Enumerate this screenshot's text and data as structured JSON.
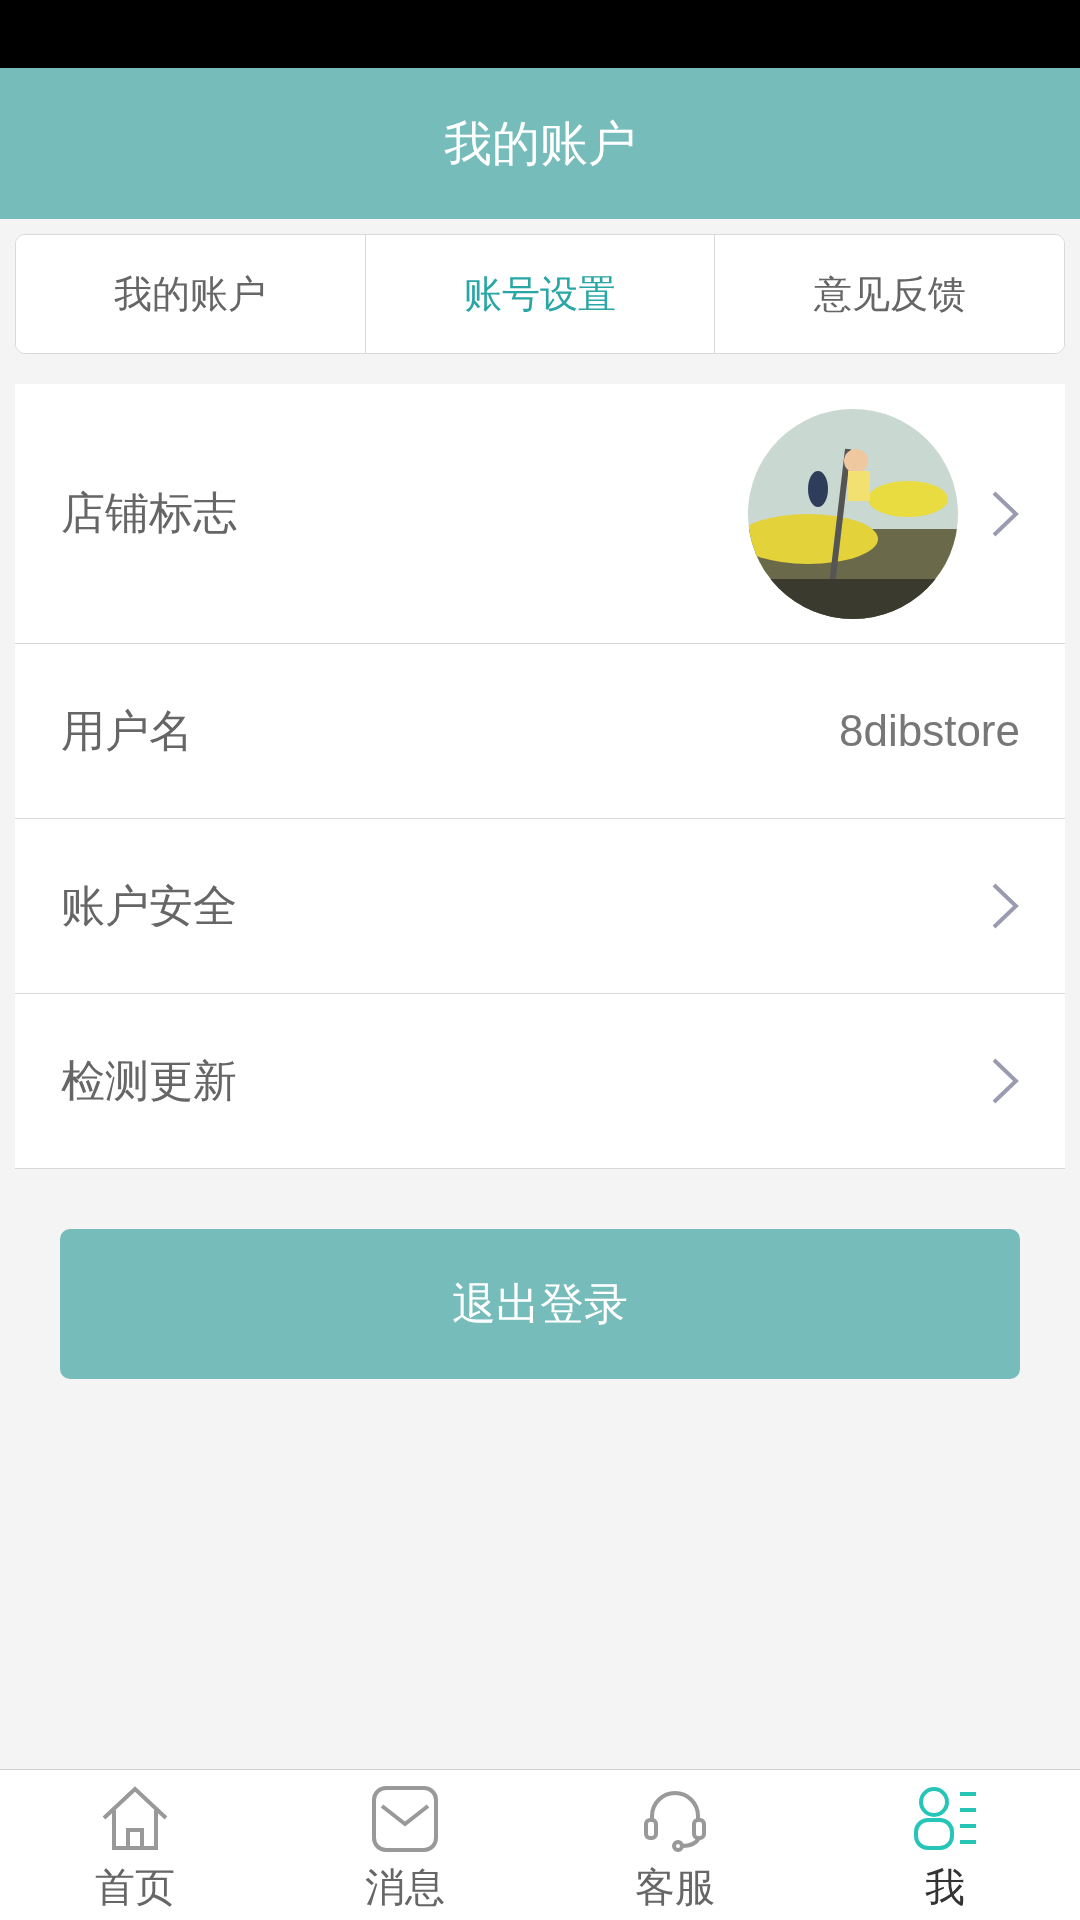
{
  "header": {
    "title": "我的账户"
  },
  "tabs": [
    {
      "label": "我的账户",
      "selected": false
    },
    {
      "label": "账号设置",
      "selected": true
    },
    {
      "label": "意见反馈",
      "selected": false
    }
  ],
  "rows": [
    {
      "kind": "avatar",
      "label": "店铺标志"
    },
    {
      "kind": "value",
      "label": "用户名",
      "value": "8dibstore"
    },
    {
      "kind": "link",
      "label": "账户安全"
    },
    {
      "kind": "link",
      "label": "检测更新"
    }
  ],
  "logout_button": "退出登录",
  "nav": [
    {
      "label": "首页",
      "selected": false
    },
    {
      "label": "消息",
      "selected": false
    },
    {
      "label": "客服",
      "selected": false
    },
    {
      "label": "我",
      "selected": true
    }
  ]
}
